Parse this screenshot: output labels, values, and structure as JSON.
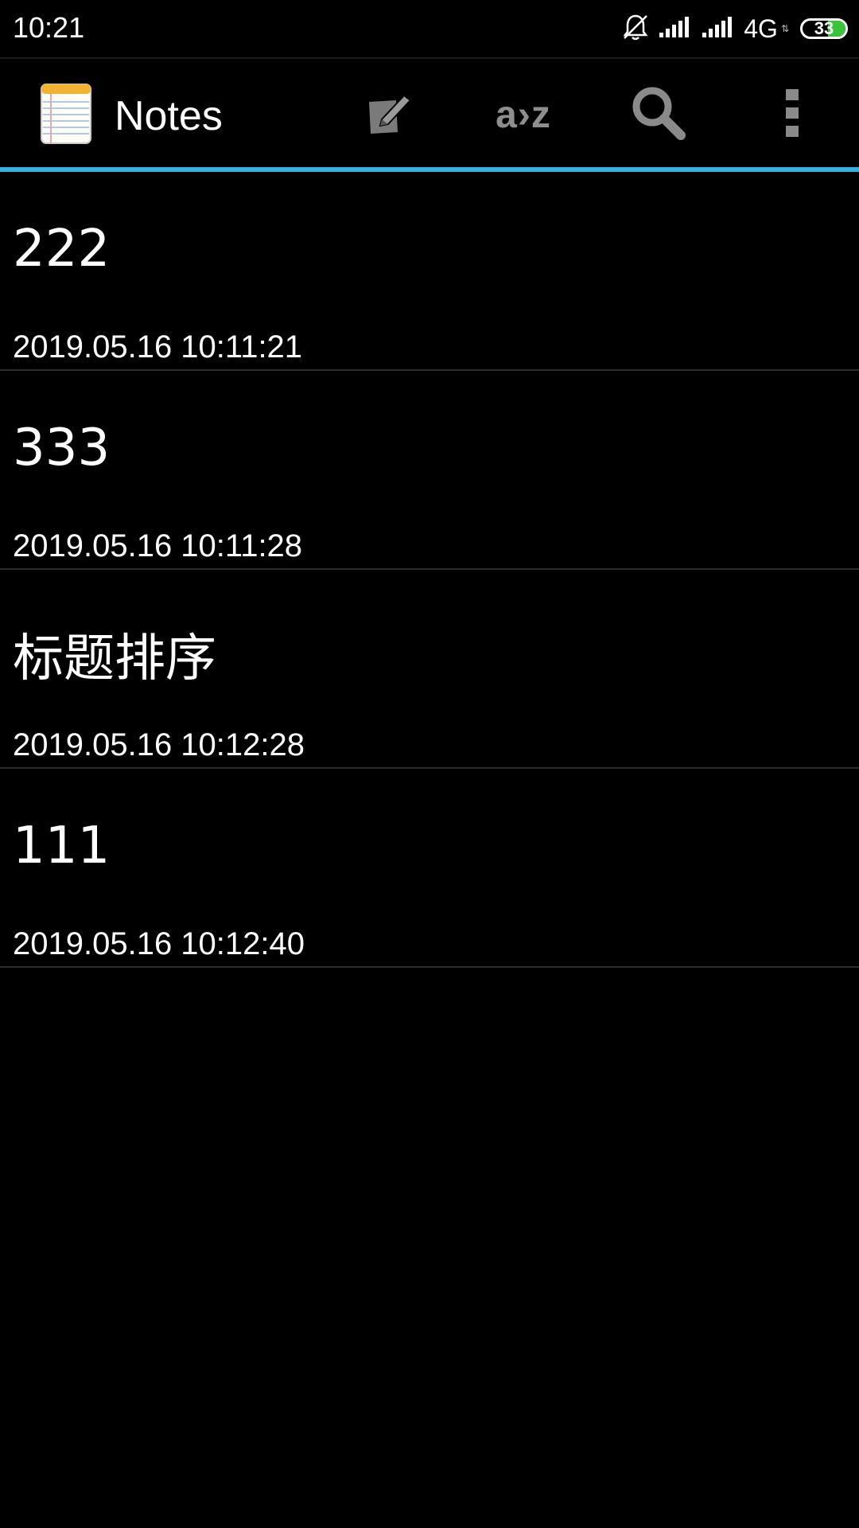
{
  "status_bar": {
    "time": "10:21",
    "network": "4G",
    "network_arrows": "⇅",
    "battery_level": "33",
    "battery_color": "#39c43a"
  },
  "action_bar": {
    "title": "Notes",
    "sort_label": "a›z",
    "accent_color": "#35b2e4",
    "icons": [
      "notepad-app-icon",
      "new-note-icon",
      "sort-icon",
      "search-icon",
      "overflow-menu-icon"
    ]
  },
  "notes": [
    {
      "title": "222",
      "timestamp": "2019.05.16 10:11:21"
    },
    {
      "title": "333",
      "timestamp": "2019.05.16 10:11:28"
    },
    {
      "title": "标题排序",
      "timestamp": "2019.05.16 10:12:28"
    },
    {
      "title": "111",
      "timestamp": "2019.05.16 10:12:40"
    }
  ]
}
